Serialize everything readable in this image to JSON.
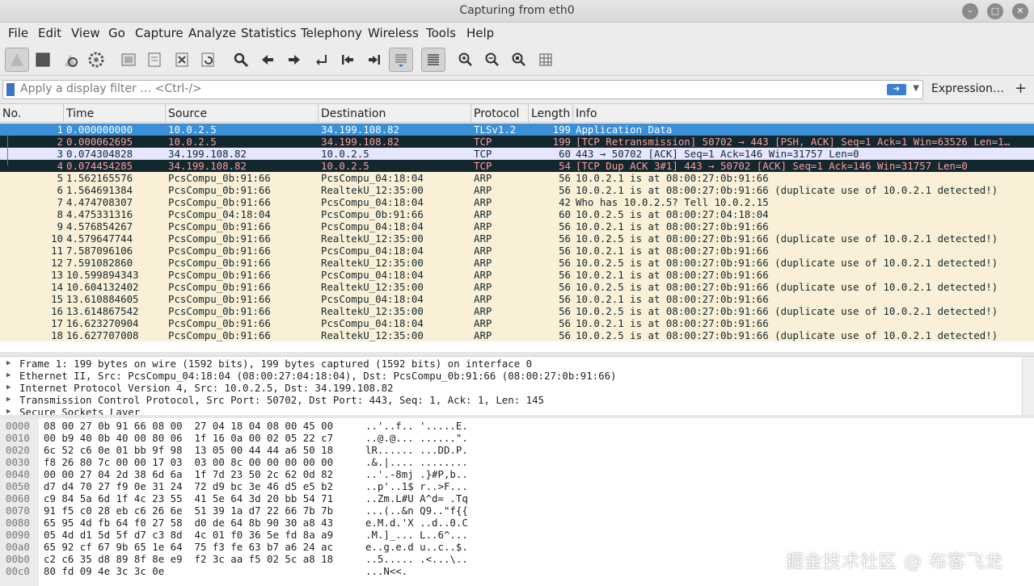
{
  "window": {
    "title": "Capturing from eth0",
    "controls": [
      "●",
      "●",
      "✕"
    ]
  },
  "menu": [
    "File",
    "Edit",
    "View",
    "Go",
    "Capture",
    "Analyze",
    "Statistics",
    "Telephony",
    "Wireless",
    "Tools",
    "Help"
  ],
  "filter": {
    "placeholder": "Apply a display filter … <Ctrl-/>",
    "expression_label": "Expression…",
    "add_label": "+"
  },
  "columns": [
    "No.",
    "Time",
    "Source",
    "Destination",
    "Protocol",
    "Length",
    "Info"
  ],
  "colors": {
    "selected_bg": "#3a8fd6",
    "dark_bg": "#12272e",
    "dark_fg": "#fa9f9f",
    "tcp_bg": "#e7e6ff",
    "arp_bg": "#faf0d7"
  },
  "packets": [
    {
      "no": "1",
      "time": "0.000000000",
      "source": "10.0.2.5",
      "destination": "34.199.108.82",
      "protocol": "TLSv1.2",
      "length": "199",
      "info": "Application Data",
      "style": "selected"
    },
    {
      "no": "2",
      "time": "0.000062695",
      "source": "10.0.2.5",
      "destination": "34.199.108.82",
      "protocol": "TCP",
      "length": "199",
      "info": "[TCP Retransmission] 50702 → 443 [PSH, ACK] Seq=1 Ack=1 Win=63526 Len=1…",
      "style": "dark"
    },
    {
      "no": "3",
      "time": "0.074304828",
      "source": "34.199.108.82",
      "destination": "10.0.2.5",
      "protocol": "TCP",
      "length": "60",
      "info": "443 → 50702 [ACK] Seq=1 Ack=146 Win=31757 Len=0",
      "style": "tcp"
    },
    {
      "no": "4",
      "time": "0.074454285",
      "source": "34.199.108.82",
      "destination": "10.0.2.5",
      "protocol": "TCP",
      "length": "54",
      "info": "[TCP Dup ACK 3#1] 443 → 50702 [ACK] Seq=1 Ack=146 Win=31757 Len=0",
      "style": "dark"
    },
    {
      "no": "5",
      "time": "1.562165576",
      "source": "PcsCompu_0b:91:66",
      "destination": "PcsCompu_04:18:04",
      "protocol": "ARP",
      "length": "56",
      "info": "10.0.2.1 is at 08:00:27:0b:91:66",
      "style": "arp"
    },
    {
      "no": "6",
      "time": "1.564691384",
      "source": "PcsCompu_0b:91:66",
      "destination": "RealtekU_12:35:00",
      "protocol": "ARP",
      "length": "56",
      "info": "10.0.2.1 is at 08:00:27:0b:91:66 (duplicate use of 10.0.2.1 detected!)",
      "style": "arp"
    },
    {
      "no": "7",
      "time": "4.474708307",
      "source": "PcsCompu_0b:91:66",
      "destination": "PcsCompu_04:18:04",
      "protocol": "ARP",
      "length": "42",
      "info": "Who has 10.0.2.5? Tell 10.0.2.15",
      "style": "arp"
    },
    {
      "no": "8",
      "time": "4.475331316",
      "source": "PcsCompu_04:18:04",
      "destination": "PcsCompu_0b:91:66",
      "protocol": "ARP",
      "length": "60",
      "info": "10.0.2.5 is at 08:00:27:04:18:04",
      "style": "arp"
    },
    {
      "no": "9",
      "time": "4.576854267",
      "source": "PcsCompu_0b:91:66",
      "destination": "PcsCompu_04:18:04",
      "protocol": "ARP",
      "length": "56",
      "info": "10.0.2.1 is at 08:00:27:0b:91:66",
      "style": "arp"
    },
    {
      "no": "10",
      "time": "4.579647744",
      "source": "PcsCompu_0b:91:66",
      "destination": "RealtekU_12:35:00",
      "protocol": "ARP",
      "length": "56",
      "info": "10.0.2.5 is at 08:00:27:0b:91:66 (duplicate use of 10.0.2.1 detected!)",
      "style": "arp"
    },
    {
      "no": "11",
      "time": "7.587096106",
      "source": "PcsCompu_0b:91:66",
      "destination": "PcsCompu_04:18:04",
      "protocol": "ARP",
      "length": "56",
      "info": "10.0.2.1 is at 08:00:27:0b:91:66",
      "style": "arp"
    },
    {
      "no": "12",
      "time": "7.591082860",
      "source": "PcsCompu_0b:91:66",
      "destination": "RealtekU_12:35:00",
      "protocol": "ARP",
      "length": "56",
      "info": "10.0.2.5 is at 08:00:27:0b:91:66 (duplicate use of 10.0.2.1 detected!)",
      "style": "arp"
    },
    {
      "no": "13",
      "time": "10.599894343",
      "source": "PcsCompu_0b:91:66",
      "destination": "PcsCompu_04:18:04",
      "protocol": "ARP",
      "length": "56",
      "info": "10.0.2.1 is at 08:00:27:0b:91:66",
      "style": "arp"
    },
    {
      "no": "14",
      "time": "10.604132402",
      "source": "PcsCompu_0b:91:66",
      "destination": "RealtekU_12:35:00",
      "protocol": "ARP",
      "length": "56",
      "info": "10.0.2.5 is at 08:00:27:0b:91:66 (duplicate use of 10.0.2.1 detected!)",
      "style": "arp"
    },
    {
      "no": "15",
      "time": "13.610884605",
      "source": "PcsCompu_0b:91:66",
      "destination": "PcsCompu_04:18:04",
      "protocol": "ARP",
      "length": "56",
      "info": "10.0.2.1 is at 08:00:27:0b:91:66",
      "style": "arp"
    },
    {
      "no": "16",
      "time": "13.614867542",
      "source": "PcsCompu_0b:91:66",
      "destination": "RealtekU_12:35:00",
      "protocol": "ARP",
      "length": "56",
      "info": "10.0.2.5 is at 08:00:27:0b:91:66 (duplicate use of 10.0.2.1 detected!)",
      "style": "arp"
    },
    {
      "no": "17",
      "time": "16.623270904",
      "source": "PcsCompu_0b:91:66",
      "destination": "PcsCompu_04:18:04",
      "protocol": "ARP",
      "length": "56",
      "info": "10.0.2.1 is at 08:00:27:0b:91:66",
      "style": "arp"
    },
    {
      "no": "18",
      "time": "16.627707008",
      "source": "PcsCompu_0b:91:66",
      "destination": "RealtekU_12:35:00",
      "protocol": "ARP",
      "length": "56",
      "info": "10.0.2.5 is at 08:00:27:0b:91:66 (duplicate use of 10.0.2.1 detected!)",
      "style": "arp"
    }
  ],
  "details": [
    "Frame 1: 199 bytes on wire (1592 bits), 199 bytes captured (1592 bits) on interface 0",
    "Ethernet II, Src: PcsCompu_04:18:04 (08:00:27:04:18:04), Dst: PcsCompu_0b:91:66 (08:00:27:0b:91:66)",
    "Internet Protocol Version 4, Src: 10.0.2.5, Dst: 34.199.108.82",
    "Transmission Control Protocol, Src Port: 50702, Dst Port: 443, Seq: 1, Ack: 1, Len: 145",
    "Secure Sockets Layer"
  ],
  "bytes": [
    {
      "offset": "0000",
      "hex": "08 00 27 0b 91 66 08 00  27 04 18 04 08 00 45 00",
      "ascii": "..'..f.. '.....E."
    },
    {
      "offset": "0010",
      "hex": "00 b9 40 0b 40 00 80 06  1f 16 0a 00 02 05 22 c7",
      "ascii": "..@.@... ......\"."
    },
    {
      "offset": "0020",
      "hex": "6c 52 c6 0e 01 bb 9f 98  13 05 00 44 44 a6 50 18",
      "ascii": "lR...... ...DD.P."
    },
    {
      "offset": "0030",
      "hex": "f8 26 80 7c 00 00 17 03  03 00 8c 00 00 00 00 00",
      "ascii": ".&.|.... ........"
    },
    {
      "offset": "0040",
      "hex": "00 00 27 04 2d 38 6d 6a  1f 7d 23 50 2c 62 0d 82",
      "ascii": "..'.-8mj .}#P,b.."
    },
    {
      "offset": "0050",
      "hex": "d7 d4 70 27 f9 0e 31 24  72 d9 bc 3e 46 d5 e5 b2",
      "ascii": "..p'..1$ r..>F..."
    },
    {
      "offset": "0060",
      "hex": "c9 84 5a 6d 1f 4c 23 55  41 5e 64 3d 20 bb 54 71",
      "ascii": "..Zm.L#U A^d= .Tq"
    },
    {
      "offset": "0070",
      "hex": "91 f5 c0 28 eb c6 26 6e  51 39 1a d7 22 66 7b 7b",
      "ascii": "...(..&n Q9..\"f{{"
    },
    {
      "offset": "0080",
      "hex": "65 95 4d fb 64 f0 27 58  d0 de 64 8b 90 30 a8 43",
      "ascii": "e.M.d.'X ..d..0.C"
    },
    {
      "offset": "0090",
      "hex": "05 4d d1 5d 5f d7 c3 8d  4c 01 f0 36 5e fd 8a a9",
      "ascii": ".M.]_... L..6^..."
    },
    {
      "offset": "00a0",
      "hex": "65 92 cf 67 9b 65 1e 64  75 f3 fe 63 b7 a6 24 ac",
      "ascii": "e..g.e.d u..c..$."
    },
    {
      "offset": "00b0",
      "hex": "c2 c6 35 d8 89 8f 8e e9  f2 3c aa f5 02 5c a8 18",
      "ascii": "..5..... .<...\\.."
    },
    {
      "offset": "00c0",
      "hex": "80 fd 09 4e 3c 3c 0e",
      "ascii": "...N<<."
    }
  ],
  "watermark": "掘金技术社区 @ 布客飞龙"
}
